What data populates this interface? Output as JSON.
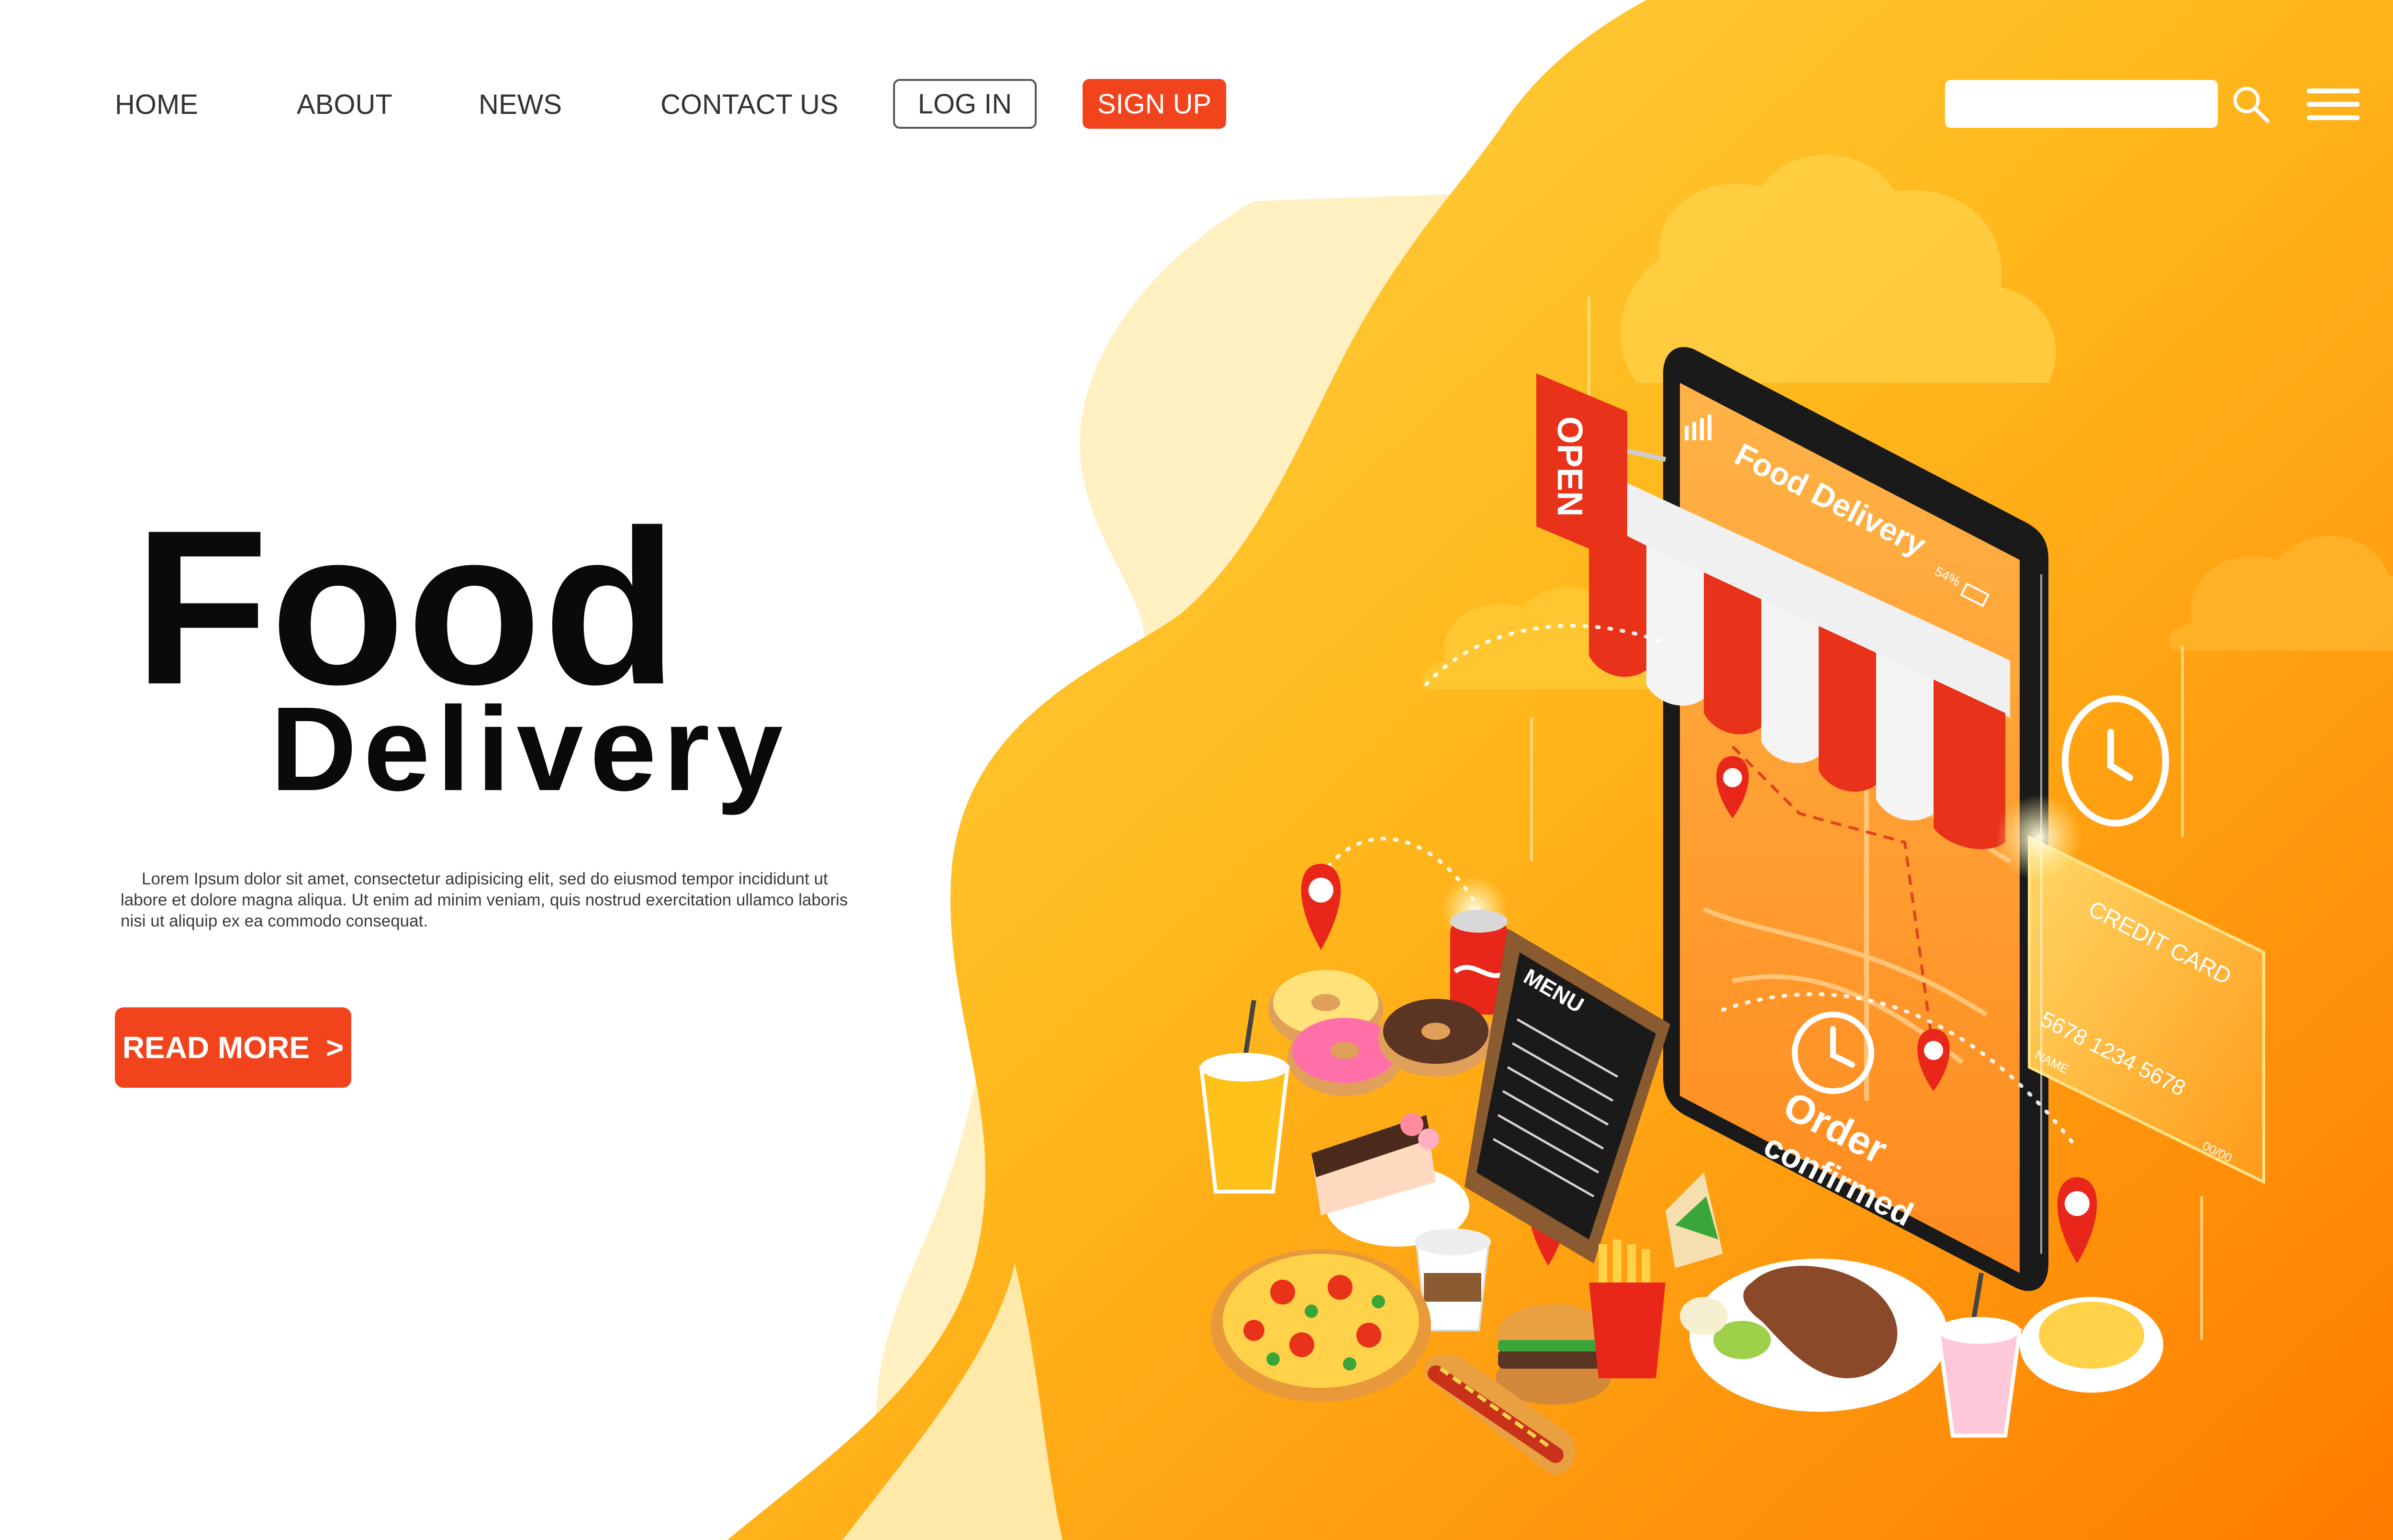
{
  "nav": {
    "home": "HOME",
    "about": "ABOUT",
    "news": "NEWS",
    "contact": "CONTACT US",
    "login": "LOG IN",
    "signup": "SIGN UP",
    "search_placeholder": ""
  },
  "hero": {
    "title": "Food",
    "subtitle": "Delivery",
    "body": "Lorem Ipsum dolor sit amet, consectetur adipisicing elit, sed do eiusmod tempor incididunt ut labore et dolore magna aliqua. Ut enim ad minim veniam, quis nostrud exercitation ullamco laboris nisi ut aliquip ex ea commodo consequat.",
    "cta": "READ MORE",
    "cta_arrow": ">"
  },
  "illustration": {
    "open_sign": "OPEN",
    "phone_title": "Food Delivery",
    "battery": "54%",
    "order_line1": "Order",
    "order_line2": "confirmed",
    "menu_board": "MENU",
    "card_title": "CREDIT CARD",
    "card_number": "5678 1234 5678",
    "card_name": "NAME",
    "card_expiry": "00/00"
  },
  "icons": {
    "search": "search-icon",
    "menu": "hamburger-menu-icon",
    "clock": "clock-icon",
    "pin": "location-pin-icon"
  },
  "colors": {
    "accent": "#f2441c",
    "orange": "#ff8a00",
    "yellow": "#ffd640",
    "text": "#0a0a0a"
  }
}
